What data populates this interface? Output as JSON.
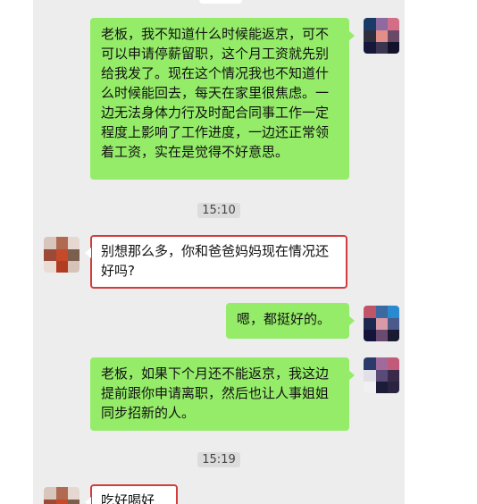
{
  "messages": [
    {
      "side": "right",
      "text": "老板，我不知道什么时候能返京，可不可以申请停薪留职，这个月工资就先别给我发了。现在这个情况我也不知道什么时候能回去，每天在家里很焦虑。一边无法身体力行及时配合同事工作一定程度上影响了工作进度，一边还正常领着工资，实在是觉得不好意思。"
    },
    {
      "side": "left",
      "text": "别想那么多，你和爸爸妈妈现在情况还好吗?",
      "highlighted": true
    },
    {
      "side": "right",
      "text": "嗯，都挺好的。"
    },
    {
      "side": "right",
      "text": "老板，如果下个月还不能返京，我这边提前跟你申请离职，然后也让人事姐姐同步招新的人。"
    },
    {
      "side": "left",
      "text": "吃好喝好",
      "highlighted": true
    }
  ],
  "timestamps": [
    "15:10",
    "15:19"
  ],
  "avatar_note": "pixelated-avatar",
  "colors": {
    "chat_bg": "#ededed",
    "sent_bubble": "#95ec69",
    "received_bubble": "#ffffff",
    "highlight_box": "#d23c3c"
  }
}
